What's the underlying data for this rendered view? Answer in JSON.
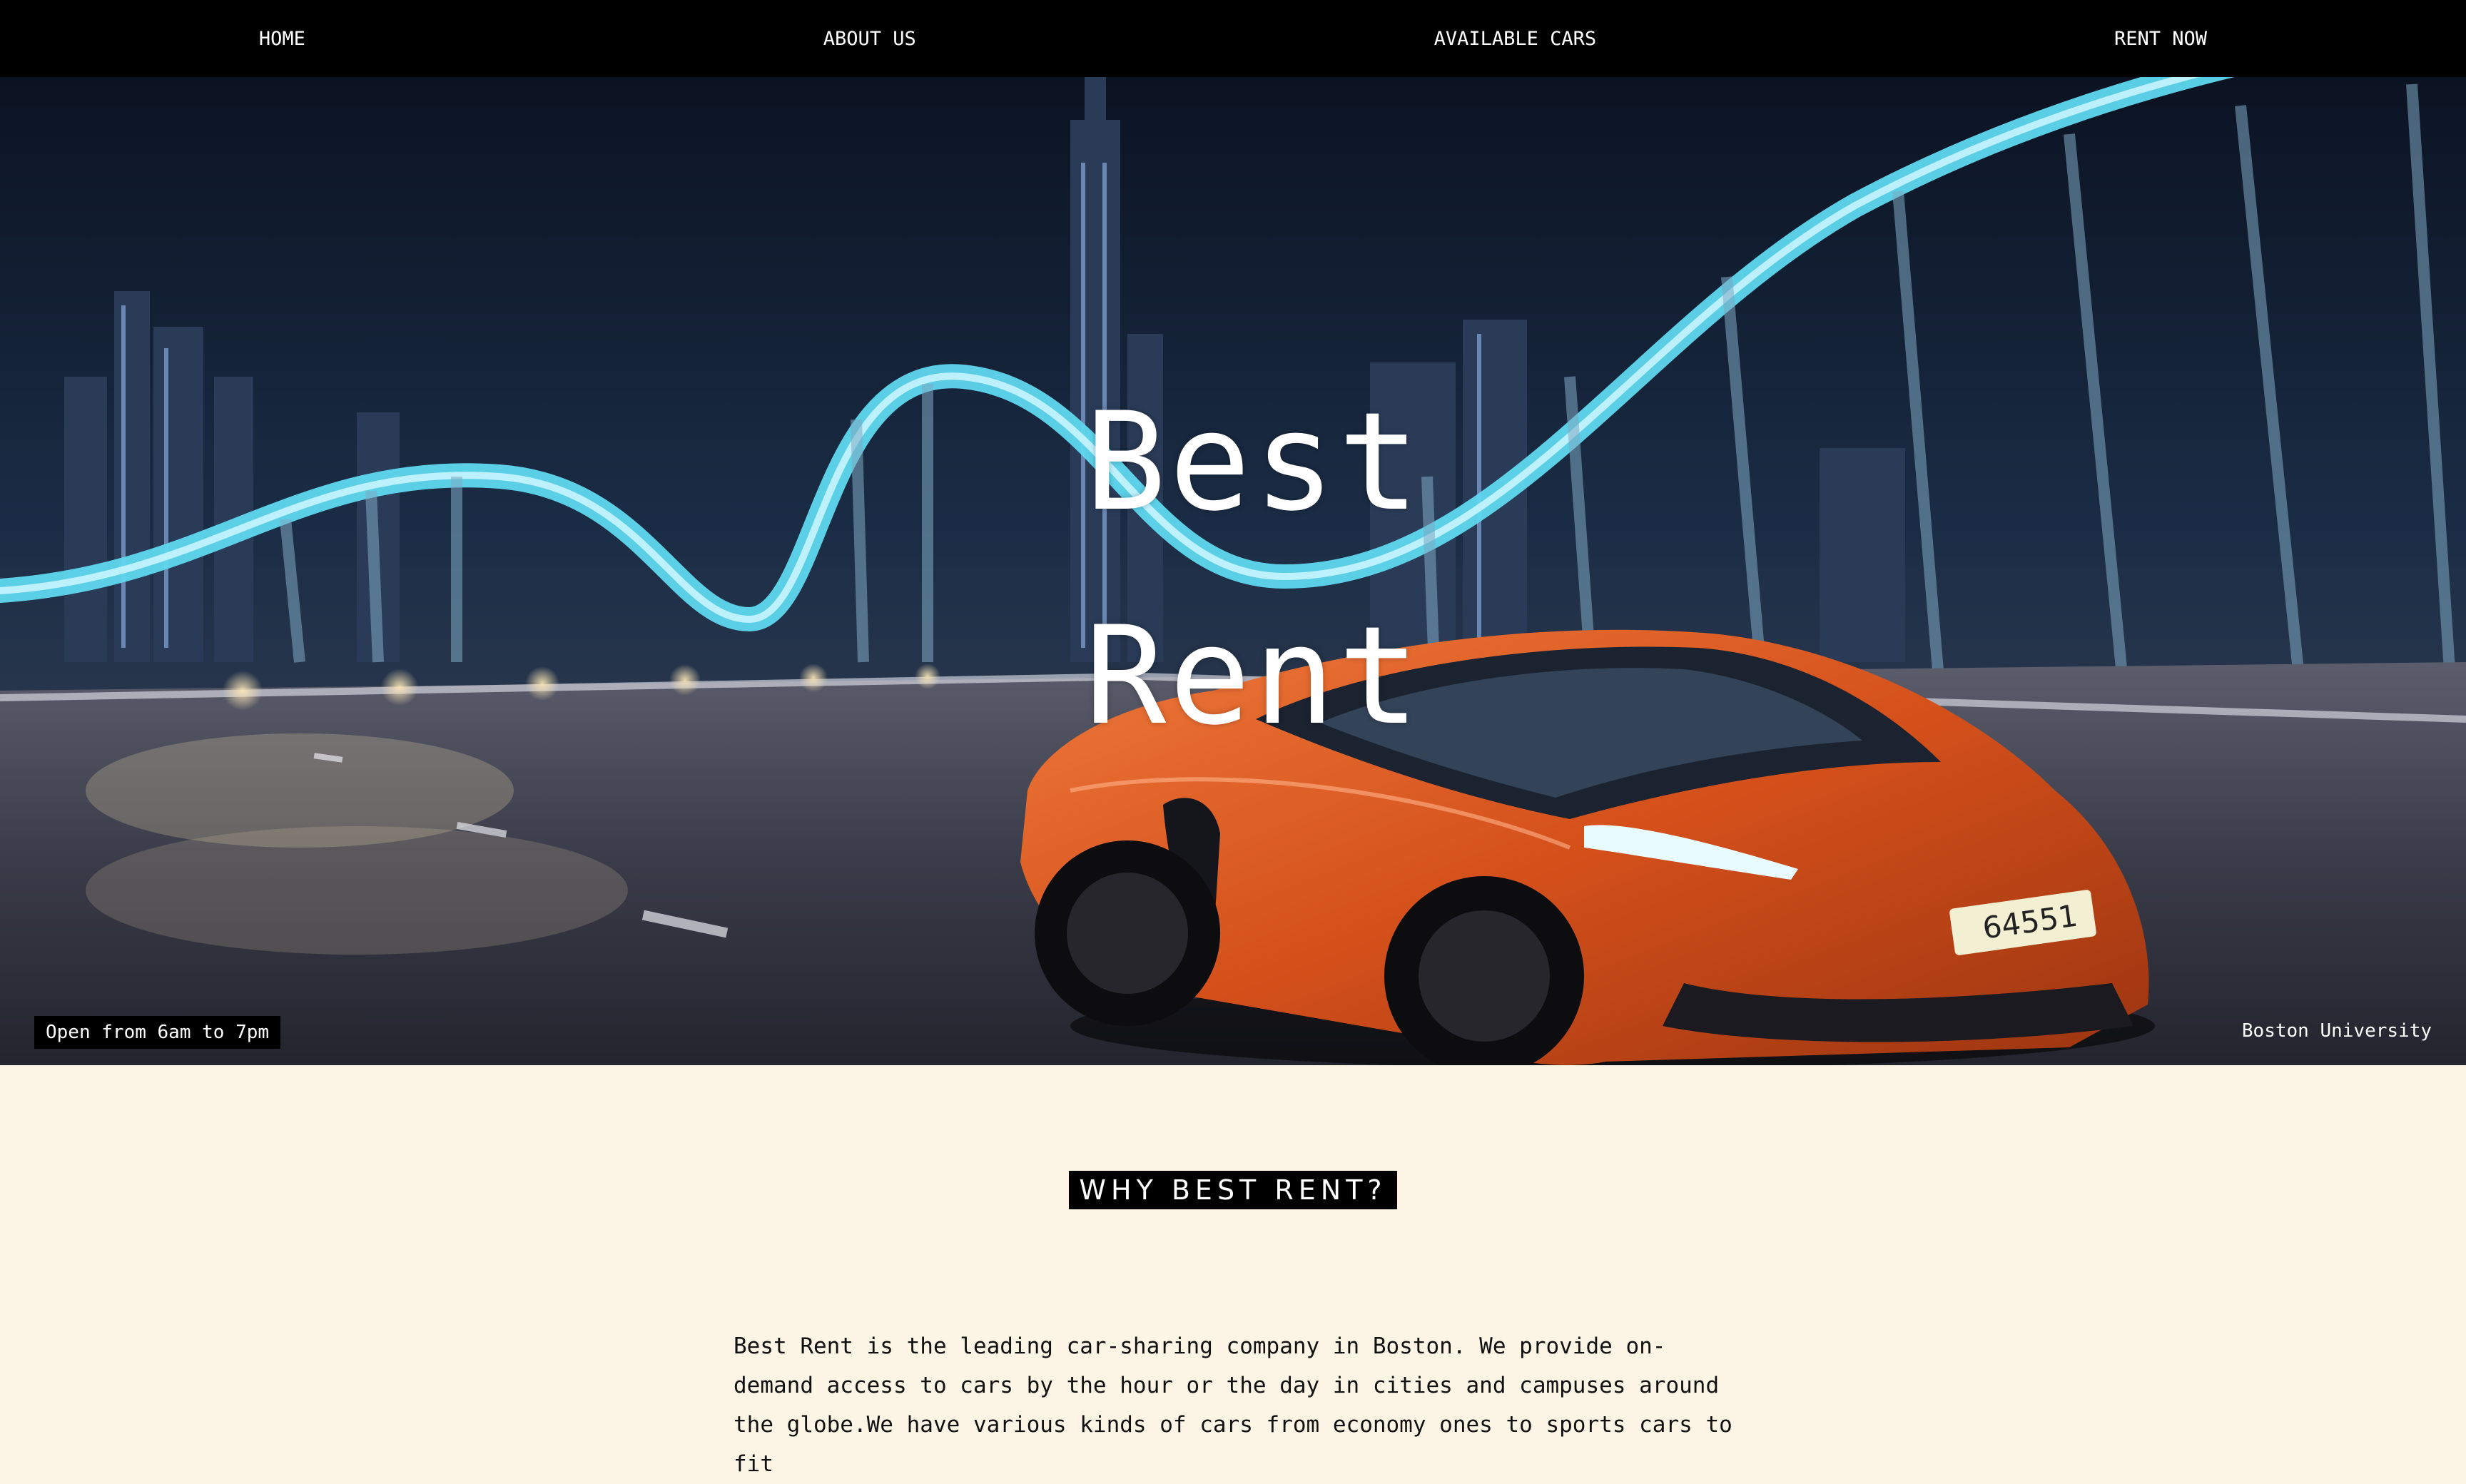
{
  "nav": {
    "items": [
      {
        "label": "HOME"
      },
      {
        "label": "ABOUT US"
      },
      {
        "label": "AVAILABLE CARS"
      },
      {
        "label": "RENT NOW"
      }
    ]
  },
  "hero": {
    "title_line1": "Best",
    "title_line2": "Rent",
    "hours": "Open from 6am to 7pm",
    "location": "Boston University",
    "plate_text": "64551"
  },
  "why": {
    "heading": "WHY BEST RENT?",
    "body": "Best Rent is the leading car-sharing company in Boston. We provide on-demand access to cars by the hour or the day in cities and campuses around the globe.We have various kinds of cars from economy ones to sports cars to fit"
  },
  "colors": {
    "nav_bg": "#000000",
    "page_bg": "#fcf5e5",
    "car_orange": "#d9541e",
    "bridge_cyan": "#5fd8ef"
  }
}
